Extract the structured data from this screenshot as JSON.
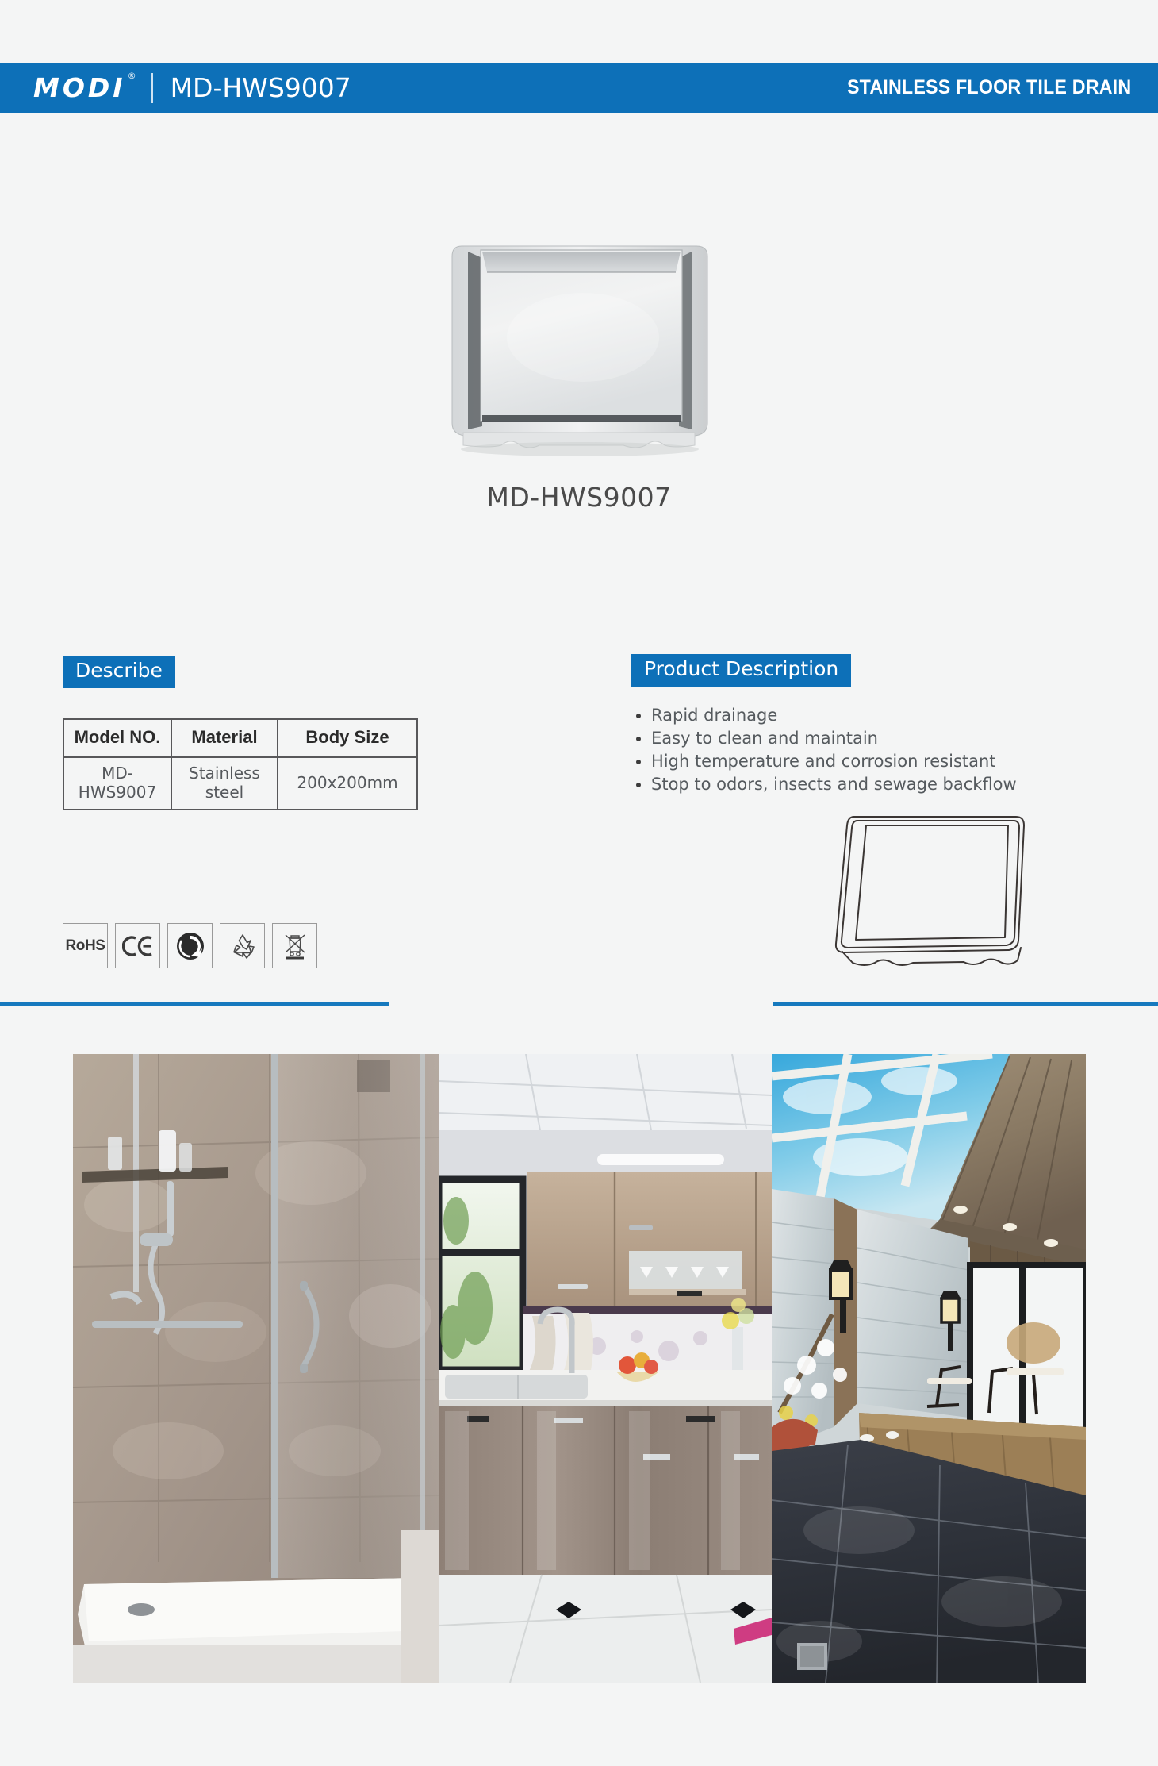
{
  "header": {
    "brand": "MODI",
    "registered_mark": "®",
    "model": "MD-HWS9007",
    "category": "STAINLESS FLOOR TILE DRAIN",
    "bar_color": "#0d70b8"
  },
  "hero": {
    "caption": "MD-HWS9007",
    "image_alt": "stainless-steel-square-tile-insert-floor-drain"
  },
  "describe": {
    "badge": "Describe",
    "table": {
      "headers": [
        "Model NO.",
        "Material",
        "Body Size"
      ],
      "rows": [
        [
          "MD-HWS9007",
          "Stainless steel",
          "200x200mm"
        ]
      ]
    }
  },
  "certifications": [
    {
      "name": "RoHS",
      "label": "RoHS"
    },
    {
      "name": "CE",
      "label": "CE"
    },
    {
      "name": "Green Dot",
      "label": ""
    },
    {
      "name": "Recycling",
      "label": ""
    },
    {
      "name": "WEEE",
      "label": ""
    }
  ],
  "product_description": {
    "badge": "Product Description",
    "features": [
      "Rapid drainage",
      "Easy to clean and maintain",
      "High temperature and corrosion resistant",
      "Stop to odors, insects and sewage backflow"
    ]
  },
  "line_drawing": {
    "alt": "technical-outline-of-square-tile-insert-drain"
  },
  "dividers": {
    "color": "#1679be"
  },
  "gallery": [
    {
      "name": "shower-enclosure",
      "alt": "Tiled shower enclosure with glass door and white shower tray"
    },
    {
      "name": "kitchen",
      "alt": "Modern kitchen with taupe gloss cabinets and tiled floor"
    },
    {
      "name": "sunroom-patio",
      "alt": "Sunroom with skylight, brick walls and dark slate tiled floor"
    }
  ]
}
